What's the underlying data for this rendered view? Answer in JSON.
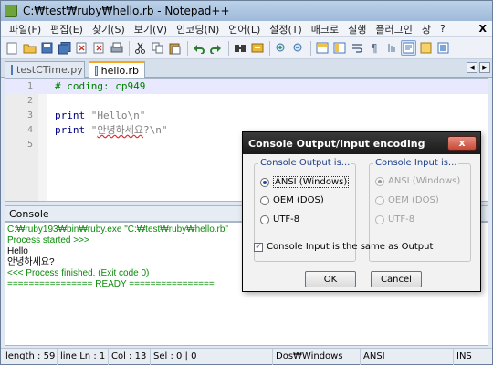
{
  "window": {
    "title": "C:₩test₩ruby₩hello.rb - Notepad++"
  },
  "menu": {
    "items": [
      "파일(F)",
      "편집(E)",
      "찾기(S)",
      "보기(V)",
      "인코딩(N)",
      "언어(L)",
      "설정(T)",
      "매크로",
      "실행",
      "플러그인",
      "창",
      "?"
    ],
    "close": "X"
  },
  "tabs": [
    {
      "label": "testCTime.py",
      "active": false
    },
    {
      "label": "hello.rb",
      "active": true
    }
  ],
  "editor": {
    "lines": [
      {
        "num": "1",
        "text": "# coding: cp949"
      },
      {
        "num": "2",
        "text": ""
      },
      {
        "num": "3",
        "kw": "print ",
        "str": "\"Hello\\n\""
      },
      {
        "num": "4",
        "kw": "print ",
        "str_open": "\"",
        "str_wavy": "안녕하세요",
        "str_close": "?\\n\""
      },
      {
        "num": "5",
        "text": ""
      }
    ]
  },
  "console": {
    "header": "Console",
    "close": "✕",
    "lines": [
      {
        "text": "C:₩ruby193₩bin₩ruby.exe \"C:₩test₩ruby₩hello.rb\"",
        "color": "green"
      },
      {
        "text": "Process started >>>",
        "color": "green"
      },
      {
        "text": "Hello",
        "color": "black"
      },
      {
        "text": "안녕하세요?",
        "color": "black"
      },
      {
        "text": "<<< Process finished. (Exit code 0)",
        "color": "green"
      },
      {
        "text": "================ READY ================",
        "color": "green"
      }
    ]
  },
  "status": {
    "length": "length : 59",
    "position": "line Ln : 1",
    "col": "Col : 13",
    "sel": "Sel : 0 | 0",
    "eol": "Dos₩Windows",
    "encoding": "ANSI",
    "mode": "INS"
  },
  "dialog": {
    "title": "Console Output/Input encoding",
    "close": "x",
    "output_group": {
      "label": "Console Output is...",
      "options": [
        "ANSI (Windows)",
        "OEM (DOS)",
        "UTF-8"
      ],
      "selected": 0
    },
    "input_group": {
      "label": "Console Input is...",
      "options": [
        "ANSI (Windows)",
        "OEM (DOS)",
        "UTF-8"
      ],
      "selected": 0
    },
    "same_checkbox": "Console Input is the same as Output",
    "ok": "OK",
    "cancel": "Cancel"
  }
}
